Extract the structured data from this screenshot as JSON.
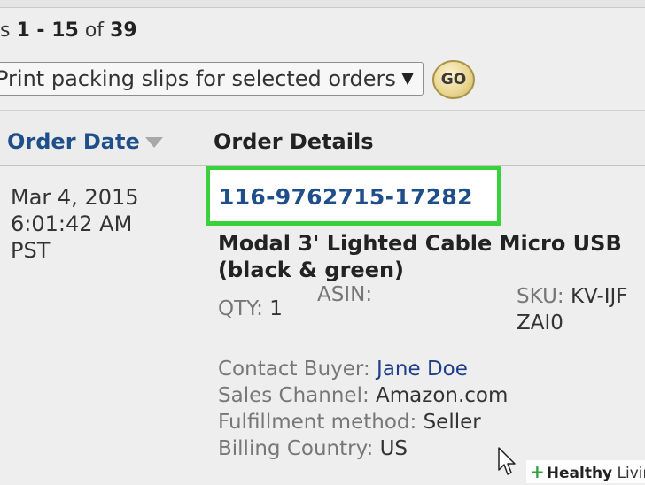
{
  "pager": {
    "prefix": "s",
    "range": "1 - 15",
    "of_label": "of",
    "total": "39"
  },
  "bulk_action": {
    "selected": "Print packing slips for selected orders",
    "go_label": "GO"
  },
  "table": {
    "columns": {
      "order_date": "Order Date",
      "order_details": "Order Details"
    },
    "rows": [
      {
        "date": "Mar 4, 2015",
        "time": "6:01:42 AM",
        "tz": "PST",
        "order_id": "116-9762715-17282",
        "product_line1": "Modal 3' Lighted Cable Micro USB",
        "product_line2": "(black & green)",
        "qty_label": "QTY:",
        "qty_value": "1",
        "asin_label": "ASIN:",
        "sku_label": "SKU:",
        "sku_value_line1": "KV-IJF",
        "sku_value_line2": "ZAI0",
        "contact_label": "Contact Buyer:",
        "contact_value": "Jane Doe",
        "channel_label": "Sales Channel:",
        "channel_value": "Amazon.com",
        "fulfillment_label": "Fulfillment method:",
        "fulfillment_value": "Seller",
        "billing_label": "Billing Country:",
        "billing_value": "US"
      }
    ]
  },
  "watermark": {
    "plus": "+",
    "bold": "Healthy",
    "light": "Living"
  },
  "colors": {
    "link": "#1f4f8a",
    "highlight": "#39d23d"
  }
}
